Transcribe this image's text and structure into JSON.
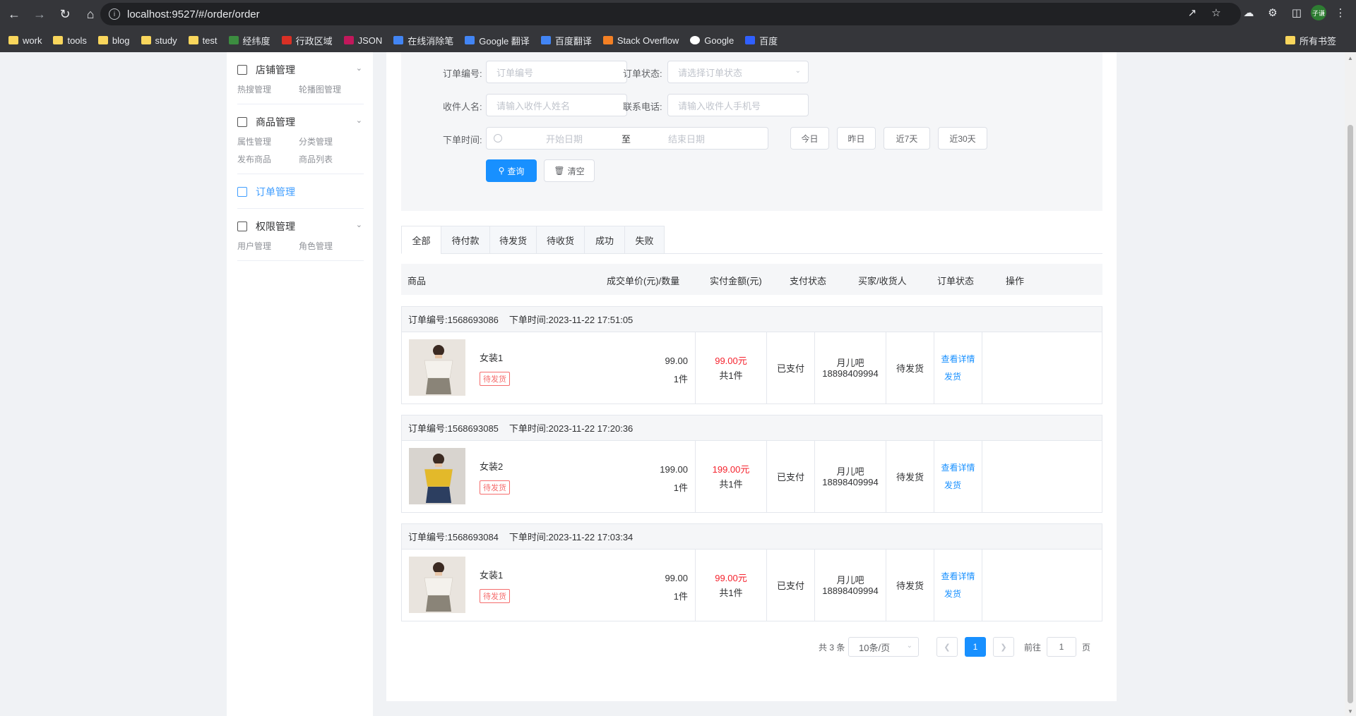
{
  "browser": {
    "url": "localhost:9527/#/order/order",
    "bookmarks": [
      {
        "label": "work",
        "icon": "folder-icon"
      },
      {
        "label": "tools",
        "icon": "folder-icon"
      },
      {
        "label": "blog",
        "icon": "folder-icon"
      },
      {
        "label": "study",
        "icon": "folder-icon"
      },
      {
        "label": "test",
        "icon": "folder-icon"
      },
      {
        "label": "经纬度",
        "icon": "map-icon"
      },
      {
        "label": "行政区域",
        "icon": "emblem-icon"
      },
      {
        "label": "JSON",
        "icon": "json-icon"
      },
      {
        "label": "在线消除笔",
        "icon": "pen-icon"
      },
      {
        "label": "Google 翻译",
        "icon": "translate-icon"
      },
      {
        "label": "百度翻译",
        "icon": "translate-icon"
      },
      {
        "label": "Stack Overflow",
        "icon": "stackoverflow-icon"
      },
      {
        "label": "Google",
        "icon": "google-icon"
      },
      {
        "label": "百度",
        "icon": "baidu-icon"
      }
    ],
    "all_bookmarks": "所有书签",
    "profile_initials": "子谦"
  },
  "sidebar": {
    "groups": [
      {
        "title": "店铺管理",
        "icon": "home-icon",
        "items": [
          "热搜管理",
          "轮播图管理"
        ]
      },
      {
        "title": "商品管理",
        "icon": "box-icon",
        "items": [
          "属性管理",
          "分类管理",
          "发布商品",
          "商品列表"
        ]
      },
      {
        "title": "订单管理",
        "icon": "document-icon",
        "items": []
      },
      {
        "title": "权限管理",
        "icon": "building-icon",
        "items": [
          "用户管理",
          "角色管理"
        ]
      }
    ]
  },
  "search": {
    "order_no_label": "订单编号:",
    "order_no_placeholder": "订单编号",
    "status_label": "订单状态:",
    "status_placeholder": "请选择订单状态",
    "receiver_label": "收件人名:",
    "receiver_placeholder": "请输入收件人姓名",
    "phone_label": "联系电话:",
    "phone_placeholder": "请输入收件人手机号",
    "time_label": "下单时间:",
    "start_placeholder": "开始日期",
    "range_sep": "至",
    "end_placeholder": "结束日期",
    "quick": [
      "今日",
      "昨日",
      "近7天",
      "近30天"
    ],
    "query_btn": "查询",
    "clear_btn": "清空"
  },
  "tabs": [
    "全部",
    "待付款",
    "待发货",
    "待收货",
    "成功",
    "失败"
  ],
  "columns": [
    "商品",
    "成交单价(元)/数量",
    "实付金额(元)",
    "支付状态",
    "买家/收货人",
    "订单状态",
    "操作"
  ],
  "orders": [
    {
      "no_label": "订单编号:1568693086",
      "time_label": "下单时间:2023-11-22 17:51:05",
      "name": "女装1",
      "badge": "待发货",
      "price": "99.00",
      "qty": "1件",
      "paid": "99.00元",
      "total_qty": "共1件",
      "pay_status": "已支付",
      "buyer": "月儿吧",
      "phone": "18898409994",
      "order_status": "待发货",
      "action_detail": "查看详情",
      "action_ship": "发货",
      "img": "white-top"
    },
    {
      "no_label": "订单编号:1568693085",
      "time_label": "下单时间:2023-11-22 17:20:36",
      "name": "女装2",
      "badge": "待发货",
      "price": "199.00",
      "qty": "1件",
      "paid": "199.00元",
      "total_qty": "共1件",
      "pay_status": "已支付",
      "buyer": "月儿吧",
      "phone": "18898409994",
      "order_status": "待发货",
      "action_detail": "查看详情",
      "action_ship": "发货",
      "img": "yellow-top"
    },
    {
      "no_label": "订单编号:1568693084",
      "time_label": "下单时间:2023-11-22 17:03:34",
      "name": "女装1",
      "badge": "待发货",
      "price": "99.00",
      "qty": "1件",
      "paid": "99.00元",
      "total_qty": "共1件",
      "pay_status": "已支付",
      "buyer": "月儿吧",
      "phone": "18898409994",
      "order_status": "待发货",
      "action_detail": "查看详情",
      "action_ship": "发货",
      "img": "white-top"
    }
  ],
  "pagination": {
    "total": "共 3 条",
    "page_size": "10条/页",
    "current": "1",
    "goto_label": "前往",
    "goto_value": "1",
    "page_label": "页"
  },
  "colors": {
    "primary": "#1890ff",
    "price_red": "#f5222d",
    "badge_red": "#f56c6c"
  }
}
